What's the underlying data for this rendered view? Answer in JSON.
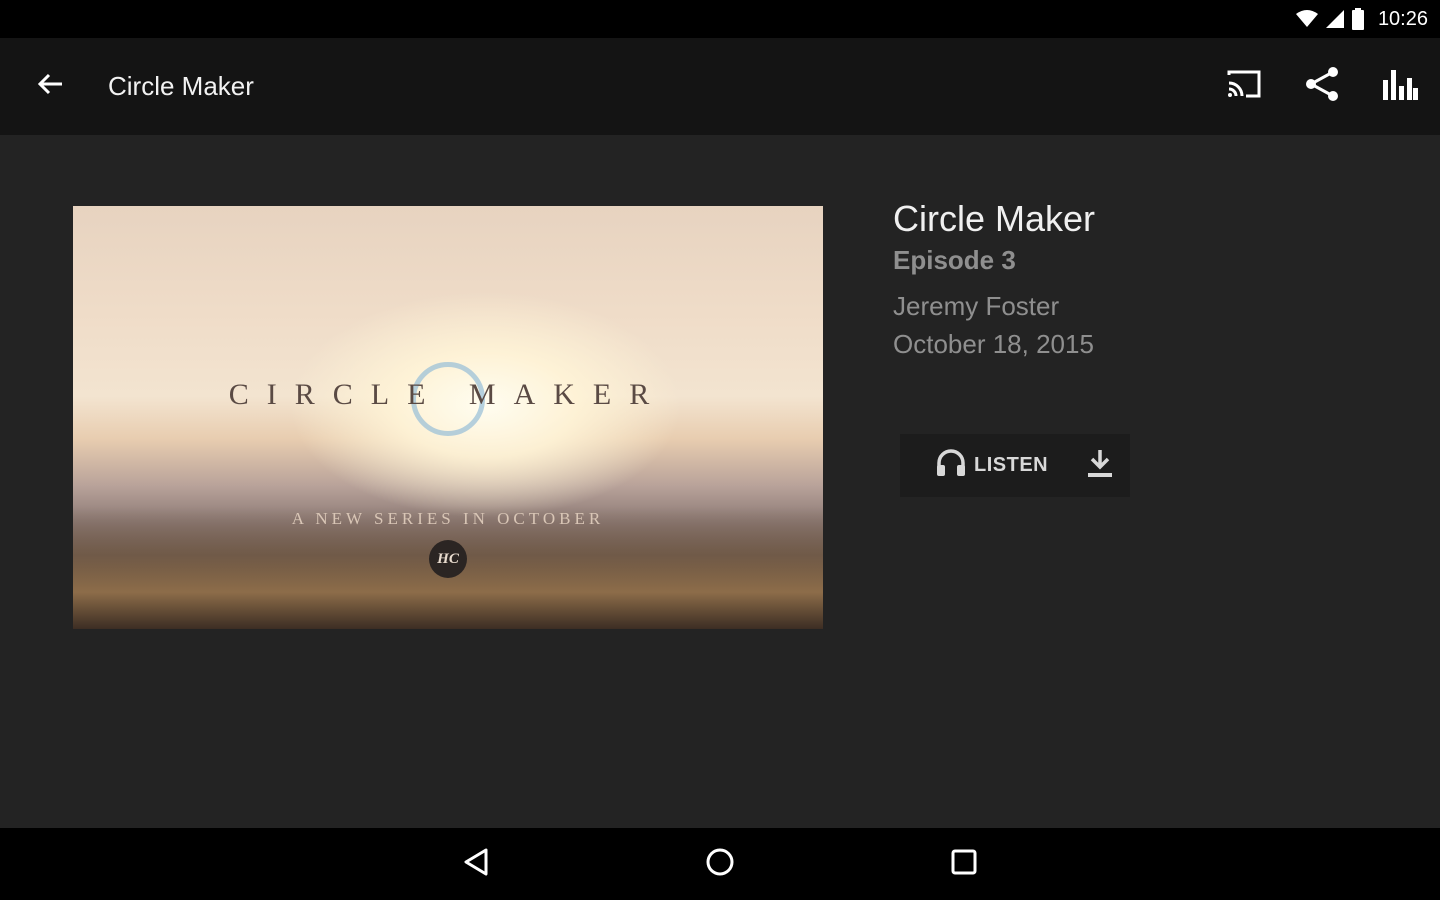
{
  "status_bar": {
    "time": "10:26",
    "icons": [
      "wifi-icon",
      "signal-icon",
      "battery-icon"
    ]
  },
  "app_bar": {
    "title": "Circle Maker",
    "back_icon": "arrow-back-icon",
    "actions": [
      "cast-icon",
      "share-icon",
      "equalizer-icon"
    ]
  },
  "artwork": {
    "series_title": "CIRCLE MAKER",
    "tagline": "A NEW SERIES IN OCTOBER",
    "logo_text": "HC"
  },
  "episode": {
    "title": "Circle Maker",
    "episode_label": "Episode 3",
    "speaker": "Jeremy Foster",
    "date": "October 18, 2015"
  },
  "actions": {
    "listen_label": "LISTEN",
    "listen_icon": "headphones-icon",
    "download_icon": "download-icon"
  },
  "nav_bar": {
    "buttons": [
      "back-triangle-icon",
      "home-circle-icon",
      "recents-square-icon"
    ]
  }
}
